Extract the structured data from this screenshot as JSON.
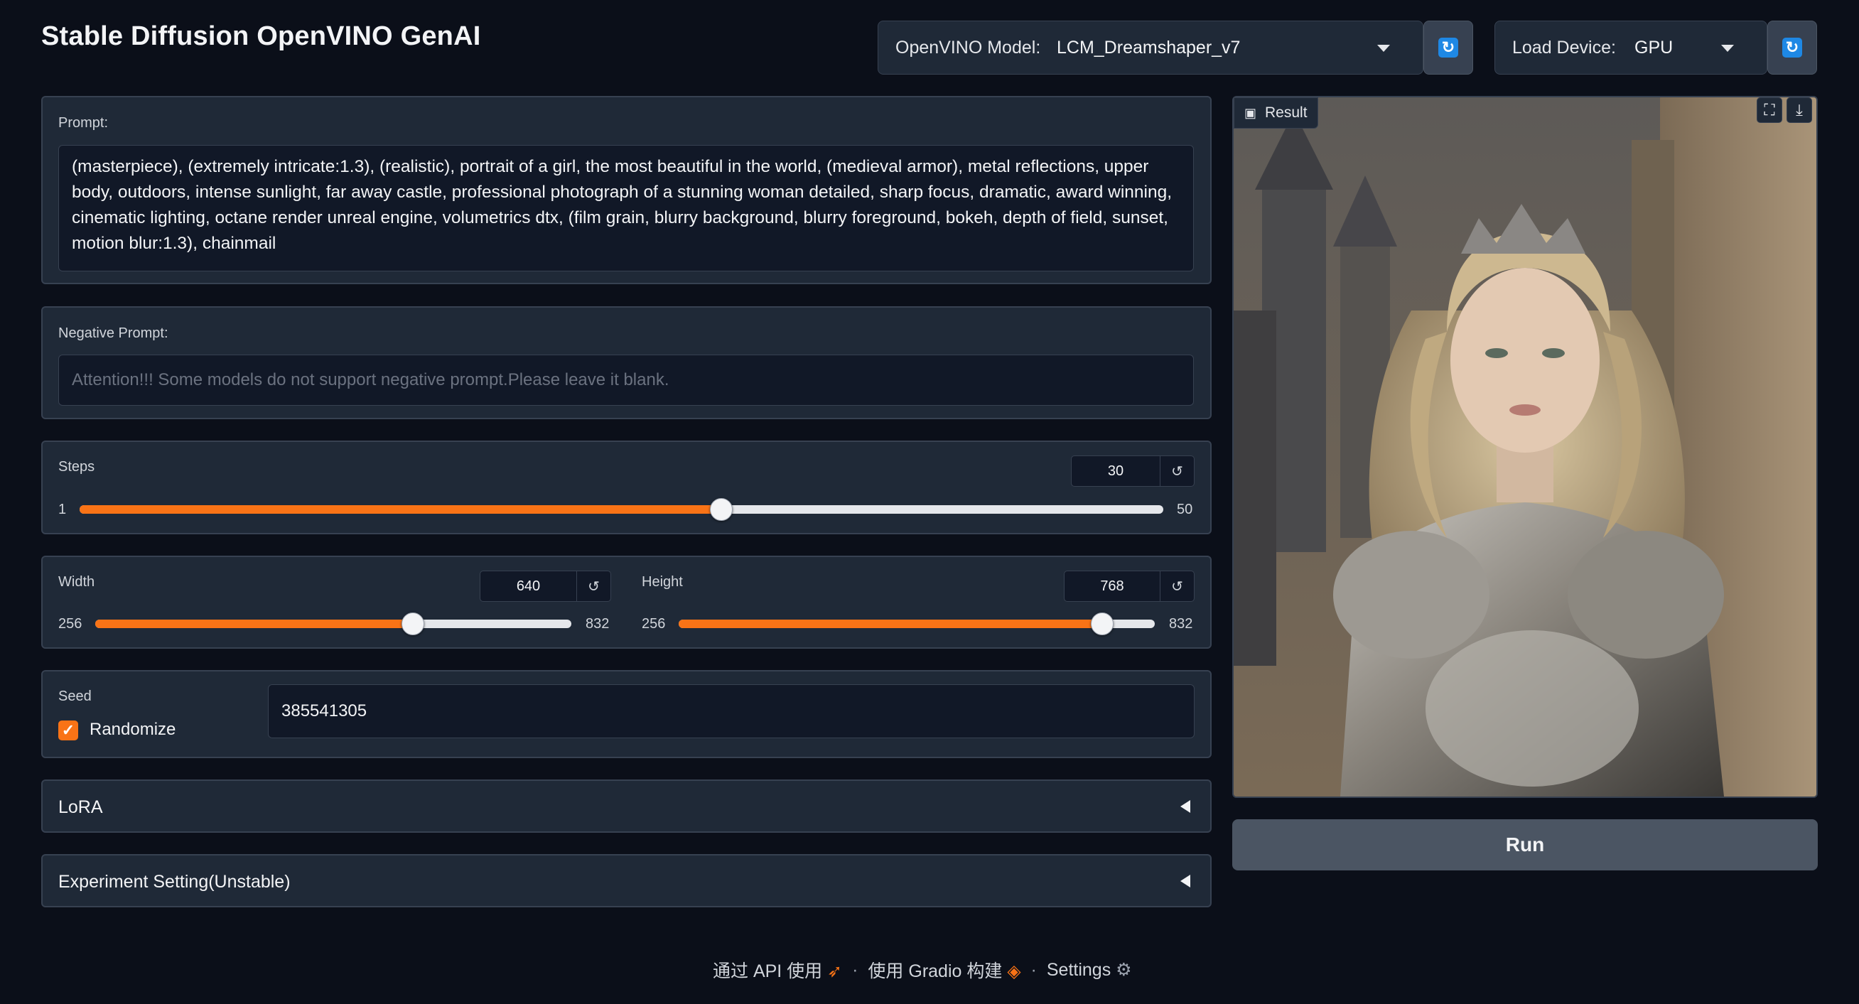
{
  "app": {
    "title": "Stable Diffusion OpenVINO GenAI"
  },
  "header": {
    "model_label": "OpenVINO Model:",
    "model_value": "LCM_Dreamshaper_v7",
    "device_label": "Load Device:",
    "device_value": "GPU"
  },
  "prompt": {
    "label": "Prompt:",
    "value": "(masterpiece), (extremely intricate:1.3), (realistic), portrait of a girl, the most beautiful in the world, (medieval armor), metal reflections, upper body, outdoors, intense sunlight, far away castle, professional photograph of a stunning woman detailed, sharp focus, dramatic, award winning, cinematic lighting, octane render  unreal engine,  volumetrics dtx, (film grain, blurry background, blurry foreground, bokeh, depth of field, sunset, motion blur:1.3), chainmail"
  },
  "negative_prompt": {
    "label": "Negative Prompt:",
    "placeholder": "Attention!!! Some models do not support negative prompt.Please leave it blank."
  },
  "steps": {
    "label": "Steps",
    "value": "30",
    "min": "1",
    "max": "50",
    "fraction": 0.592
  },
  "width": {
    "label": "Width",
    "value": "640",
    "min": "256",
    "max": "832",
    "fraction": 0.667
  },
  "height": {
    "label": "Height",
    "value": "768",
    "min": "256",
    "max": "832",
    "fraction": 0.889
  },
  "seed": {
    "label": "Seed",
    "value": "385541305",
    "randomize_label": "Randomize",
    "randomize_checked": true
  },
  "accordions": {
    "lora": "LoRA",
    "experiment": "Experiment Setting(Unstable)"
  },
  "result": {
    "label": "Result"
  },
  "run": {
    "label": "Run"
  },
  "footer": {
    "api": "通过 API 使用",
    "built": "使用 Gradio 构建",
    "settings": "Settings"
  },
  "colors": {
    "accent": "#f97316",
    "refresh": "#1e88e5",
    "background": "#0b0f19",
    "panel": "#1f2937"
  }
}
